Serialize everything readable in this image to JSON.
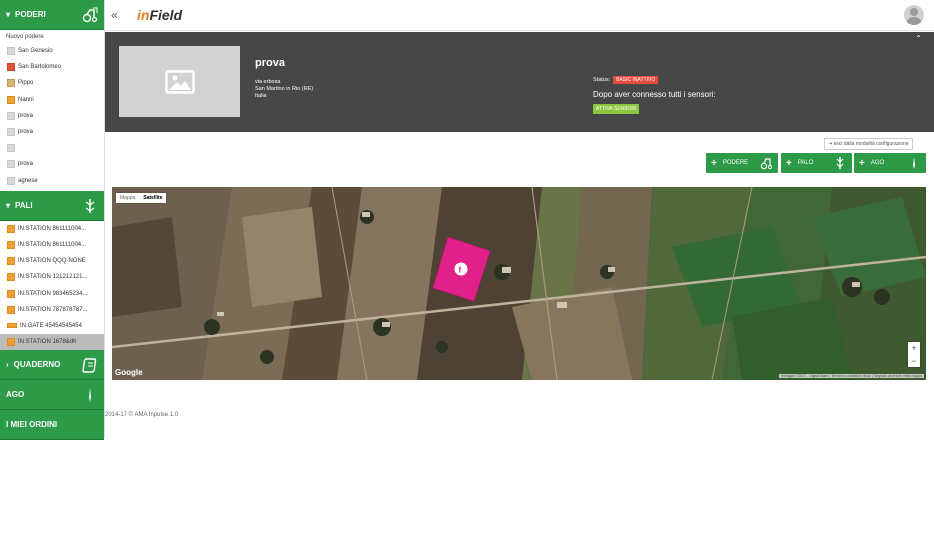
{
  "sidebar": {
    "poderi": {
      "label": "PODERI",
      "new_label": "Nuovo podere",
      "items": [
        {
          "label": "San Genesio",
          "color": "grey"
        },
        {
          "label": "San Bartolomeo",
          "color": "red"
        },
        {
          "label": "Pippo",
          "color": "beige"
        },
        {
          "label": "Nanni",
          "color": "orange"
        },
        {
          "label": "prova",
          "color": "grey"
        },
        {
          "label": "prova",
          "color": "grey"
        },
        {
          "label": "",
          "color": "grey"
        },
        {
          "label": "prova",
          "color": "grey"
        },
        {
          "label": "agnese",
          "color": "grey"
        }
      ]
    },
    "pali": {
      "label": "PALI",
      "items": [
        {
          "label": "IN.STATION 861111004..."
        },
        {
          "label": "IN.STATION 861111004..."
        },
        {
          "label": "IN.STATION QQQ-NONE"
        },
        {
          "label": "IN.STATION 121212121..."
        },
        {
          "label": "IN.STATION 983465234..."
        },
        {
          "label": "IN.STATION 787878787..."
        },
        {
          "label": "IN.GATE 45454545454"
        },
        {
          "label": "IN.STATION 1678&dh"
        }
      ]
    },
    "quaderno": {
      "label": "QUADERNO"
    },
    "ago": {
      "label": "AGO"
    },
    "ordini": {
      "label": "I MIEI ORDINI"
    }
  },
  "topbar": {
    "collapse_icon": "«",
    "logo_in": "in",
    "logo_field": "Field"
  },
  "header": {
    "name": "prova",
    "address_line1": "via erbosa",
    "address_line2": "San Martino in Rio (RE)",
    "address_line3": "Italia",
    "status_label": "Status:",
    "status_value": "BASIC INATTIVO",
    "connect_text": "Dopo aver connesso tutti i sensori:",
    "activate_button": "ATTIVA SENSORI",
    "collapse_up": "⌃"
  },
  "exit_config": "esci dalla modalità configurazione",
  "actions": {
    "podere": "PODERE",
    "palo": "PALO",
    "ago": "AGO"
  },
  "map": {
    "tab_map": "Mappa",
    "tab_satellite": "Satellite",
    "google": "Google",
    "attribution": "Immagini ©2017 , DigitalGlobe  |  Termini e condizioni d'uso  |  Segnala un errore nella mappa",
    "zoom_in": "+",
    "zoom_out": "−"
  },
  "footer": "2014-17 © AMA Inpulse 1.0",
  "colors": {
    "green": "#2d9a47",
    "header_bg": "#474747",
    "status_red": "#e74c3c",
    "activate_green": "#8ec63f",
    "parcel_magenta": "#e0218a",
    "logo_orange": "#e67e22"
  }
}
